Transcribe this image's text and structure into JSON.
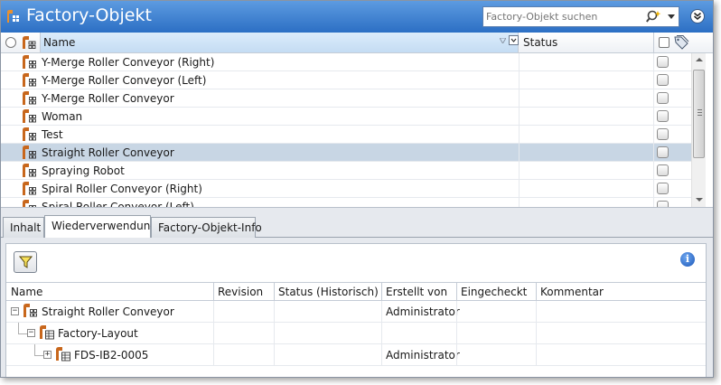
{
  "window": {
    "title": "Factory-Objekt",
    "search_placeholder": "Factory-Objekt suchen"
  },
  "list": {
    "columns": {
      "name": "Name",
      "status": "Status"
    },
    "rows": [
      {
        "name": "Y-Merge Roller Conveyor (Right)",
        "status": "",
        "selected": false
      },
      {
        "name": "Y-Merge Roller Conveyor (Left)",
        "status": "",
        "selected": false
      },
      {
        "name": "Y-Merge Roller Conveyor",
        "status": "",
        "selected": false
      },
      {
        "name": "Woman",
        "status": "",
        "selected": false
      },
      {
        "name": "Test",
        "status": "",
        "selected": false
      },
      {
        "name": "Straight Roller Conveyor",
        "status": "",
        "selected": true
      },
      {
        "name": "Spraying Robot",
        "status": "",
        "selected": false
      },
      {
        "name": "Spiral Roller Conveyor (Right)",
        "status": "",
        "selected": false
      },
      {
        "name": "Spiral Roller Conveyor (Left)",
        "status": "",
        "selected": false
      }
    ]
  },
  "tabs": [
    {
      "label": "Inhalt",
      "active": false
    },
    {
      "label": "Wiederverwendung",
      "active": true
    },
    {
      "label": "Factory-Objekt-Info",
      "active": false
    }
  ],
  "usage_table": {
    "columns": {
      "name": "Name",
      "revision": "Revision",
      "status_hist": "Status (Historisch)",
      "created_by": "Erstellt von",
      "checked_in": "Eingecheckt",
      "comment": "Kommentar"
    },
    "rows": [
      {
        "name": "Straight Roller Conveyor",
        "revision": "",
        "status_hist": "",
        "created_by": "Administrator",
        "checked_in": "",
        "comment": "",
        "expander": "−",
        "icon": "factory-object-icon"
      },
      {
        "name": "Factory-Layout",
        "revision": "",
        "status_hist": "",
        "created_by": "",
        "checked_in": "",
        "comment": "",
        "expander": "−",
        "icon": "factory-layout-icon"
      },
      {
        "name": "FDS-IB2-0005",
        "revision": "",
        "status_hist": "",
        "created_by": "Administrator",
        "checked_in": "",
        "comment": "",
        "expander": "+",
        "icon": "factory-layout-icon"
      }
    ]
  },
  "colors": {
    "titlebar": "#2c6fc4",
    "selection": "#c8d6e4",
    "icon_orange": "#c8671c",
    "info": "#1a56b8"
  }
}
